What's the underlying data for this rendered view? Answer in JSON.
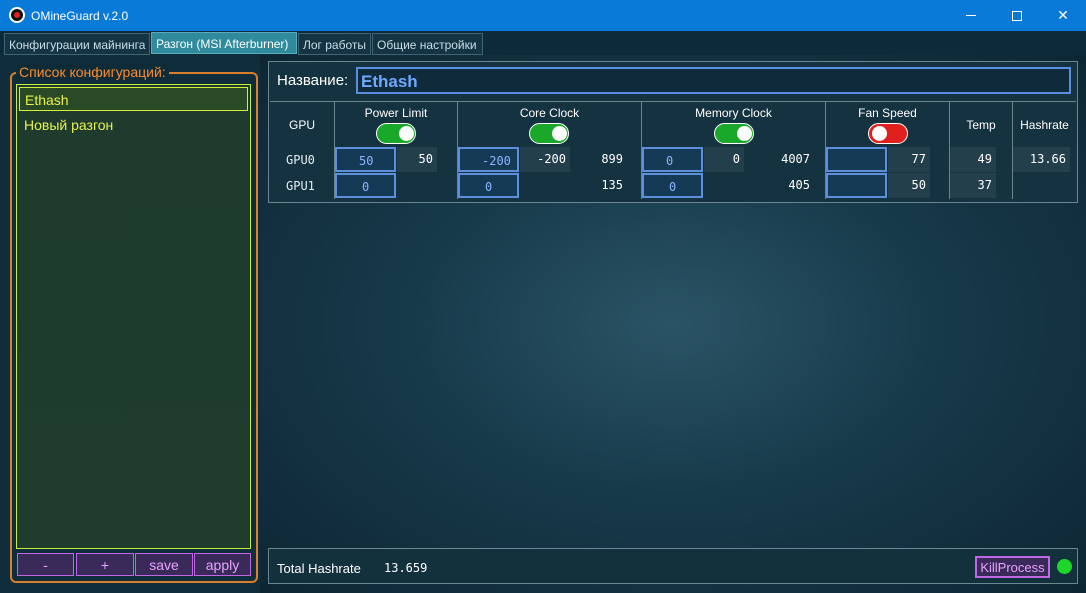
{
  "window": {
    "title": "OMineGuard v.2.0"
  },
  "tabs": [
    {
      "label": "Конфигурации майнинга"
    },
    {
      "label": "Разгон (MSI Afterburner)"
    },
    {
      "label": "Лог работы"
    },
    {
      "label": "Общие настройки"
    }
  ],
  "config_list": {
    "title": "Список конфигураций:",
    "items": [
      {
        "label": "Ethash",
        "selected": true
      },
      {
        "label": "Новый разгон",
        "selected": false
      }
    ],
    "buttons": {
      "remove": "-",
      "add": "+",
      "save": "save",
      "apply": "apply"
    }
  },
  "overclock": {
    "name_label": "Название:",
    "name_value": "Ethash",
    "headers": {
      "gpu": "GPU",
      "power_limit": "Power Limit",
      "core_clock": "Core Clock",
      "memory_clock": "Memory Clock",
      "fan_speed": "Fan Speed",
      "temp": "Temp",
      "hashrate": "Hashrate"
    },
    "toggles": {
      "power_limit": true,
      "core_clock": true,
      "memory_clock": true,
      "fan_speed": false
    },
    "rows": [
      {
        "gpu": "GPU0",
        "power_limit_input": "50",
        "power_limit_current": "50",
        "core_clock_input": "-200",
        "core_clock_current": "-200",
        "core_clock_actual": "899",
        "memory_clock_input": "0",
        "memory_clock_current": "0",
        "memory_clock_actual": "4007",
        "fan_speed_input": "",
        "fan_speed_current": "77",
        "temp": "49",
        "hashrate": "13.66"
      },
      {
        "gpu": "GPU1",
        "power_limit_input": "0",
        "power_limit_current": "",
        "core_clock_input": "0",
        "core_clock_current": "",
        "core_clock_actual": "135",
        "memory_clock_input": "0",
        "memory_clock_current": "",
        "memory_clock_actual": "405",
        "fan_speed_input": "",
        "fan_speed_current": "50",
        "temp": "37",
        "hashrate": ""
      }
    ]
  },
  "footer": {
    "total_label": "Total Hashrate",
    "total_value": "13.659",
    "kill_button": "KillProcess",
    "status": "running"
  },
  "colors": {
    "titlebar": "#0a7ad8",
    "accent_orange": "#ff8a2a",
    "accent_yellow": "#e7f44a",
    "accent_purple": "#e8a2ff",
    "toggle_on": "#1aa82a",
    "toggle_off": "#e01f1f",
    "status_ok": "#1ed62a"
  }
}
